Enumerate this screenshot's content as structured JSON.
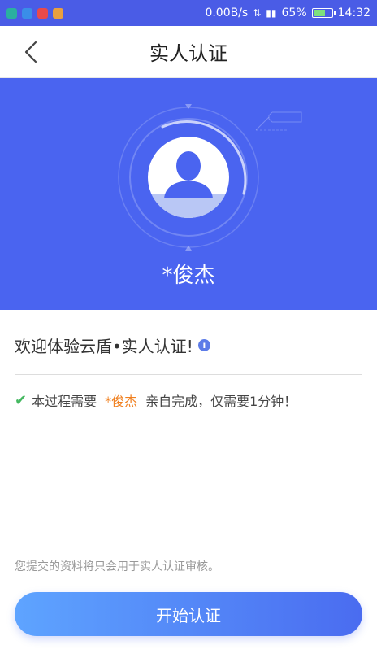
{
  "status_bar": {
    "network_speed": "0.00B/s",
    "battery_percent": "65%",
    "time": "14:32",
    "app_icons": [
      "app-icon-teal",
      "app-icon-blue",
      "app-icon-red",
      "app-icon-orange"
    ],
    "colors": {
      "background": "#4a5ce6"
    }
  },
  "header": {
    "title": "实人认证"
  },
  "hero": {
    "name": "*俊杰",
    "colors": {
      "background": "#4a64f0"
    }
  },
  "welcome": {
    "text": "欢迎体验云盾•实人认证!",
    "info_icon": "i"
  },
  "requirement": {
    "prefix": "本过程需要",
    "name": "*俊杰",
    "suffix": "亲自完成，仅需要1分钟！"
  },
  "footer": {
    "disclaimer": "您提交的资料将只会用于实人认证审核。",
    "start_label": "开始认证"
  },
  "colors": {
    "accent": "#4a64f0",
    "highlight": "#f08020",
    "check": "#44b860"
  }
}
